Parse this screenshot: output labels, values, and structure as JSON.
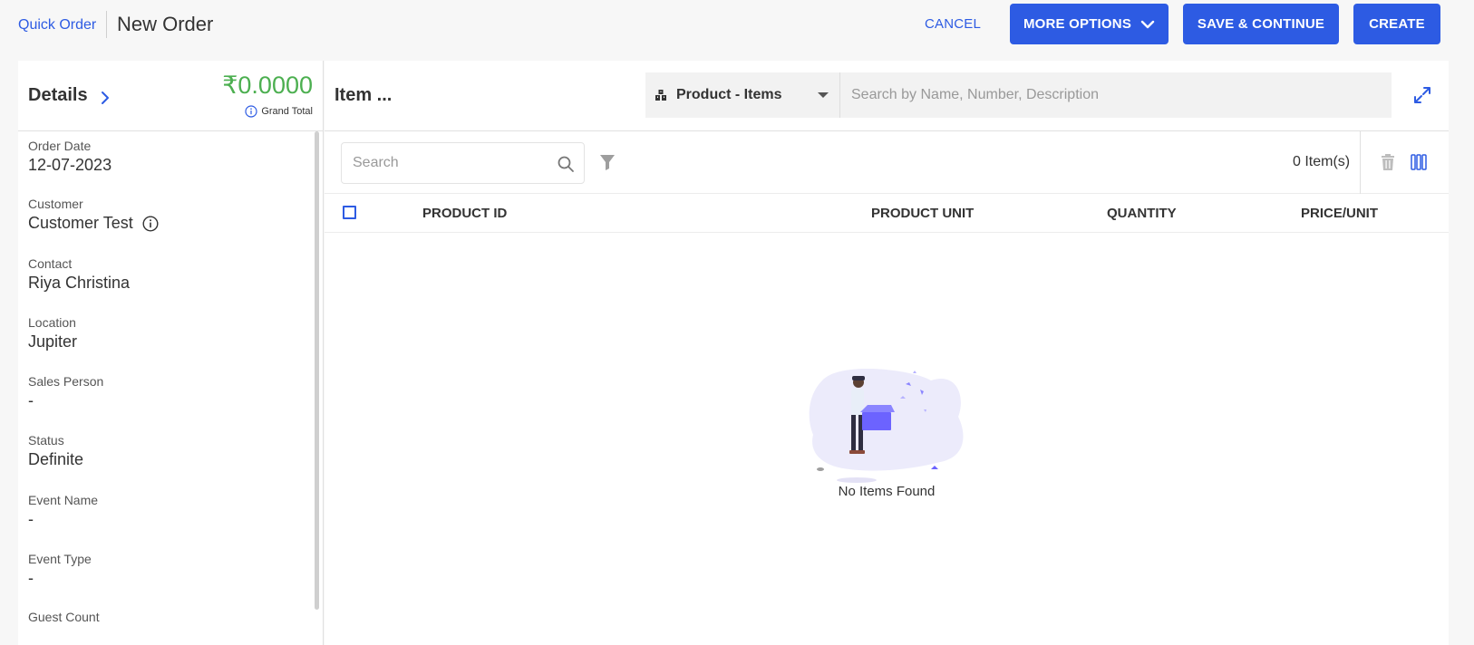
{
  "header": {
    "breadcrumb": "Quick Order",
    "title": "New Order",
    "cancel_label": "CANCEL",
    "more_options_label": "MORE OPTIONS",
    "save_continue_label": "SAVE & CONTINUE",
    "create_label": "CREATE"
  },
  "details": {
    "title": "Details",
    "grand_total_amount": "₹0.0000",
    "grand_total_label": "Grand Total",
    "fields": [
      {
        "label": "Order Date",
        "value": "12-07-2023"
      },
      {
        "label": "Customer",
        "value": "Customer Test"
      },
      {
        "label": "Contact",
        "value": "Riya Christina"
      },
      {
        "label": "Location",
        "value": "Jupiter"
      },
      {
        "label": "Sales Person",
        "value": "-"
      },
      {
        "label": "Status",
        "value": "Definite"
      },
      {
        "label": "Event Name",
        "value": "-"
      },
      {
        "label": "Event Type",
        "value": "-"
      },
      {
        "label": "Guest Count",
        "value": ""
      }
    ]
  },
  "items": {
    "title": "Item ...",
    "product_select_label": "Product - Items",
    "product_search_placeholder": "Search by Name, Number, Description",
    "search_placeholder": "Search",
    "item_count": "0 Item(s)",
    "columns": [
      "PRODUCT ID",
      "PRODUCT UNIT",
      "QUANTITY",
      "PRICE/UNIT"
    ],
    "empty_text": "No Items Found"
  },
  "colors": {
    "primary": "#2d5be3",
    "grand_total": "#4caf50"
  },
  "icons": [
    "chevron-down-icon",
    "chevron-right-icon",
    "info-icon",
    "product-items-icon",
    "expand-icon",
    "search-icon",
    "filter-icon",
    "trash-icon",
    "columns-icon"
  ]
}
